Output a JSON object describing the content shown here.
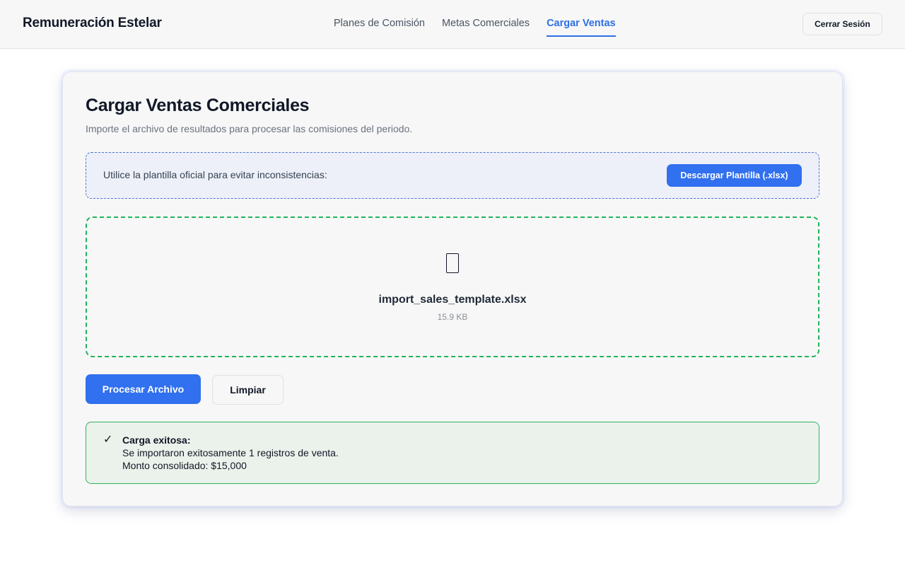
{
  "header": {
    "brand": "Remuneración Estelar",
    "nav": [
      {
        "label": "Planes de Comisión",
        "active": false
      },
      {
        "label": "Metas Comerciales",
        "active": false
      },
      {
        "label": "Cargar Ventas",
        "active": true
      }
    ],
    "logout_label": "Cerrar Sesión"
  },
  "card": {
    "title": "Cargar Ventas Comerciales",
    "subtitle": "Importe el archivo de resultados para procesar las comisiones del periodo.",
    "template_notice": "Utilice la plantilla oficial para evitar inconsistencias:",
    "template_button": "Descargar Plantilla (.xlsx)",
    "dropzone": {
      "icon": "file-icon",
      "file_name": "import_sales_template.xlsx",
      "file_size": "15.9 KB"
    },
    "process_button": "Procesar Archivo",
    "clear_button": "Limpiar",
    "result": {
      "icon": "✓",
      "title": "Carga exitosa:",
      "message": "Se importaron exitosamente 1 registros de venta.",
      "amount": "Monto consolidado: $15,000"
    }
  },
  "colors": {
    "accent": "#3170ee",
    "active_nav": "#2f6fe4",
    "success_border": "#2fb35b",
    "success_bg": "#ebf2eb",
    "notice_bg": "#edf0f8"
  }
}
